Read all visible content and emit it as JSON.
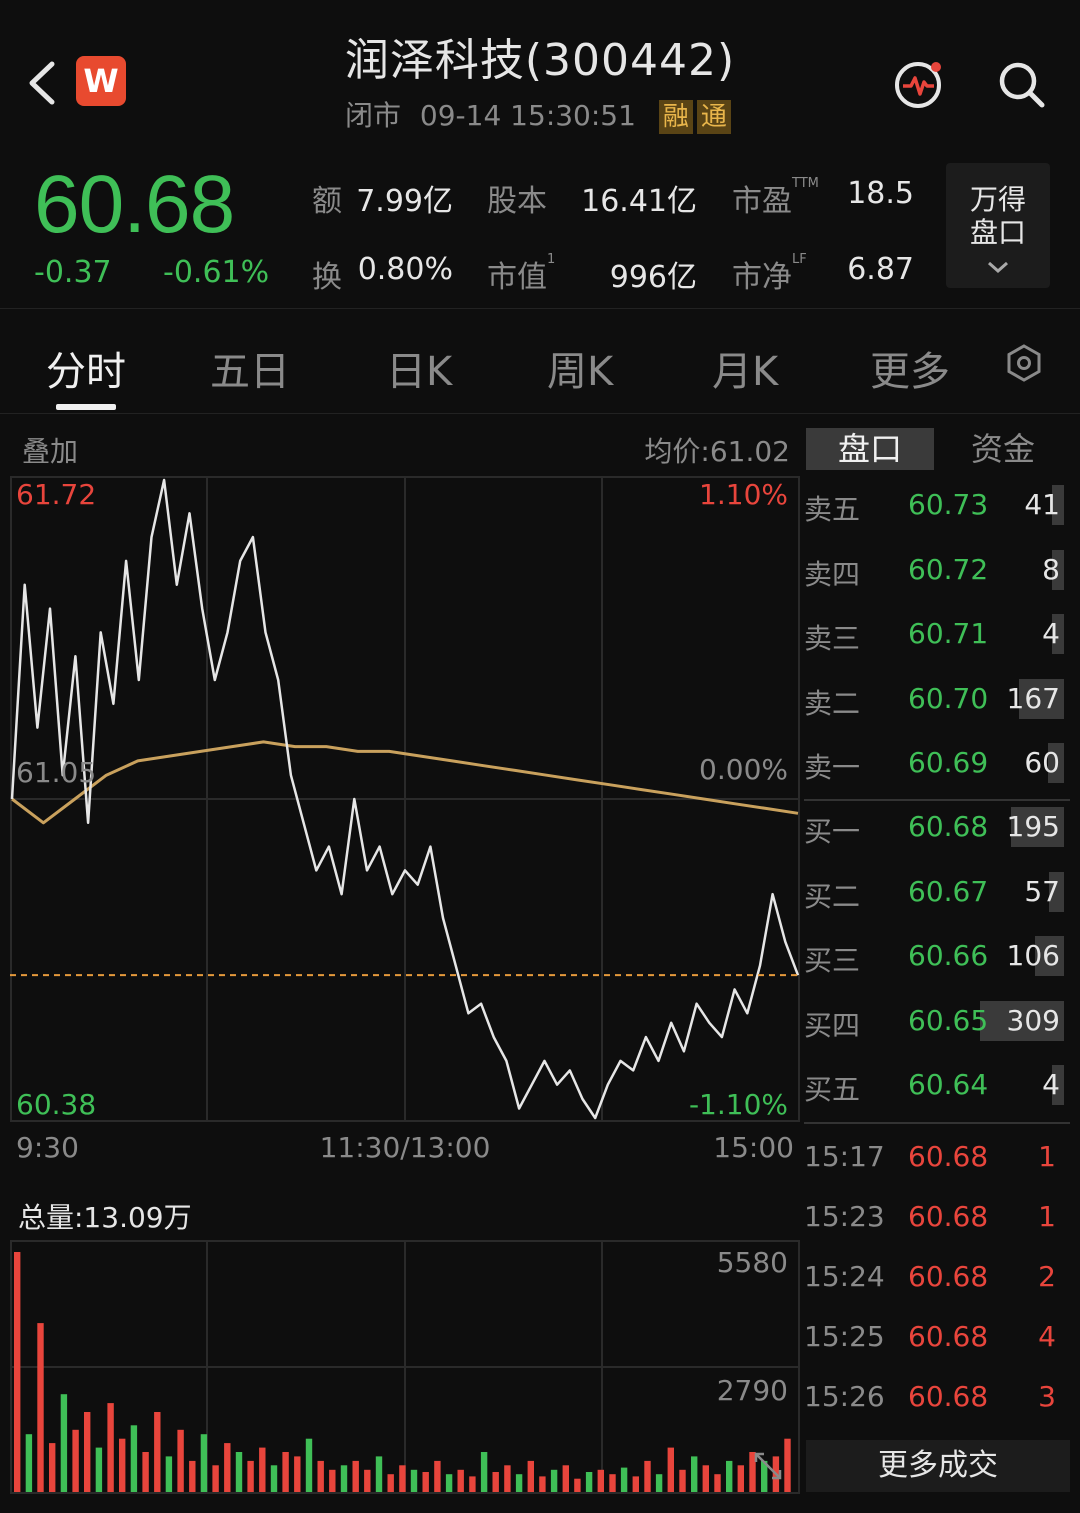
{
  "header": {
    "back_icon": "chevron-left-icon",
    "logo_letter": "W",
    "title": "润泽科技(300442)",
    "status": "闭市",
    "datetime": "09-14 15:30:51",
    "tags": [
      "融",
      "通"
    ],
    "pulse_icon": "pulse-icon",
    "search_icon": "search-icon"
  },
  "quote": {
    "price": "60.68",
    "change": "-0.37",
    "change_pct": "-0.61%",
    "stats": [
      {
        "label": "额",
        "sup": "",
        "value": "7.99亿"
      },
      {
        "label": "股本",
        "sup": "",
        "value": "16.41亿"
      },
      {
        "label": "市盈",
        "sup": "TTM",
        "value": "18.5"
      },
      {
        "label": "换",
        "sup": "",
        "value": "0.80%"
      },
      {
        "label": "市值",
        "sup": "1",
        "value": "996亿"
      },
      {
        "label": "市净",
        "sup": "LF",
        "value": "6.87"
      }
    ],
    "wande_button": [
      "万得",
      "盘口"
    ]
  },
  "tabs": [
    "分时",
    "五日",
    "日K",
    "周K",
    "月K",
    "更多"
  ],
  "chart": {
    "overlay_label": "叠加",
    "avg_price_label": "均价:61.02",
    "y_high": "61.72",
    "y_mid": "61.05",
    "y_low": "60.38",
    "pct_high": "1.10%",
    "pct_mid": "0.00%",
    "pct_low": "-1.10%",
    "time_start": "9:30",
    "time_mid": "11:30/13:00",
    "time_end": "15:00",
    "total_volume": "总量:13.09万",
    "vol_high": "5580",
    "vol_mid": "2790"
  },
  "chart_data": {
    "type": "line",
    "x_range": [
      "9:30",
      "15:00"
    ],
    "ylim": [
      60.38,
      61.72
    ],
    "prev_close": 61.05,
    "series": [
      {
        "name": "价格",
        "values": [
          61.05,
          61.5,
          61.2,
          61.45,
          61.1,
          61.35,
          61.0,
          61.4,
          61.25,
          61.55,
          61.3,
          61.6,
          61.72,
          61.5,
          61.65,
          61.45,
          61.3,
          61.4,
          61.55,
          61.6,
          61.4,
          61.3,
          61.1,
          61.0,
          60.9,
          60.95,
          60.85,
          61.05,
          60.9,
          60.95,
          60.85,
          60.9,
          60.87,
          60.95,
          60.8,
          60.7,
          60.6,
          60.62,
          60.55,
          60.5,
          60.4,
          60.45,
          60.5,
          60.45,
          60.48,
          60.42,
          60.38,
          60.45,
          60.5,
          60.48,
          60.55,
          60.5,
          60.58,
          60.52,
          60.62,
          60.58,
          60.55,
          60.65,
          60.6,
          60.7,
          60.85,
          60.75,
          60.68
        ]
      },
      {
        "name": "均价",
        "values": [
          61.05,
          61.0,
          61.05,
          61.1,
          61.13,
          61.14,
          61.15,
          61.16,
          61.17,
          61.16,
          61.16,
          61.15,
          61.15,
          61.14,
          61.13,
          61.12,
          61.11,
          61.1,
          61.09,
          61.08,
          61.07,
          61.06,
          61.05,
          61.04,
          61.03,
          61.02
        ]
      }
    ],
    "volume_ylim": [
      0,
      5580
    ],
    "volume": [
      5400,
      1300,
      3800,
      1100,
      2200,
      1400,
      1800,
      1000,
      2000,
      1200,
      1500,
      900,
      1800,
      800,
      1400,
      700,
      1300,
      600,
      1100,
      900,
      700,
      1000,
      600,
      900,
      800,
      1200,
      700,
      500,
      600,
      700,
      500,
      800,
      400,
      600,
      500,
      450,
      700,
      400,
      500,
      350,
      900,
      450,
      600,
      400,
      700,
      350,
      500,
      600,
      300,
      450,
      500,
      400,
      550,
      350,
      700,
      400,
      1000,
      500,
      800,
      600,
      400,
      700,
      600,
      900,
      700,
      800,
      1200
    ]
  },
  "orderbook": {
    "segments": [
      "盘口",
      "资金"
    ],
    "asks": [
      {
        "label": "卖五",
        "price": "60.73",
        "vol": "41"
      },
      {
        "label": "卖四",
        "price": "60.72",
        "vol": "8"
      },
      {
        "label": "卖三",
        "price": "60.71",
        "vol": "4"
      },
      {
        "label": "卖二",
        "price": "60.70",
        "vol": "167"
      },
      {
        "label": "卖一",
        "price": "60.69",
        "vol": "60"
      }
    ],
    "bids": [
      {
        "label": "买一",
        "price": "60.68",
        "vol": "195"
      },
      {
        "label": "买二",
        "price": "60.67",
        "vol": "57"
      },
      {
        "label": "买三",
        "price": "60.66",
        "vol": "106"
      },
      {
        "label": "买四",
        "price": "60.65",
        "vol": "309"
      },
      {
        "label": "买五",
        "price": "60.64",
        "vol": "4"
      }
    ],
    "trades": [
      {
        "time": "15:17",
        "price": "60.68",
        "vol": "1"
      },
      {
        "time": "15:23",
        "price": "60.68",
        "vol": "1"
      },
      {
        "time": "15:24",
        "price": "60.68",
        "vol": "2"
      },
      {
        "time": "15:25",
        "price": "60.68",
        "vol": "4"
      },
      {
        "time": "15:26",
        "price": "60.68",
        "vol": "3"
      }
    ],
    "more_trades": "更多成交"
  },
  "colors": {
    "up": "#e8453c",
    "down": "#3fbf57",
    "avg_line": "#c9a15d",
    "price_line": "#e6e6e6"
  }
}
